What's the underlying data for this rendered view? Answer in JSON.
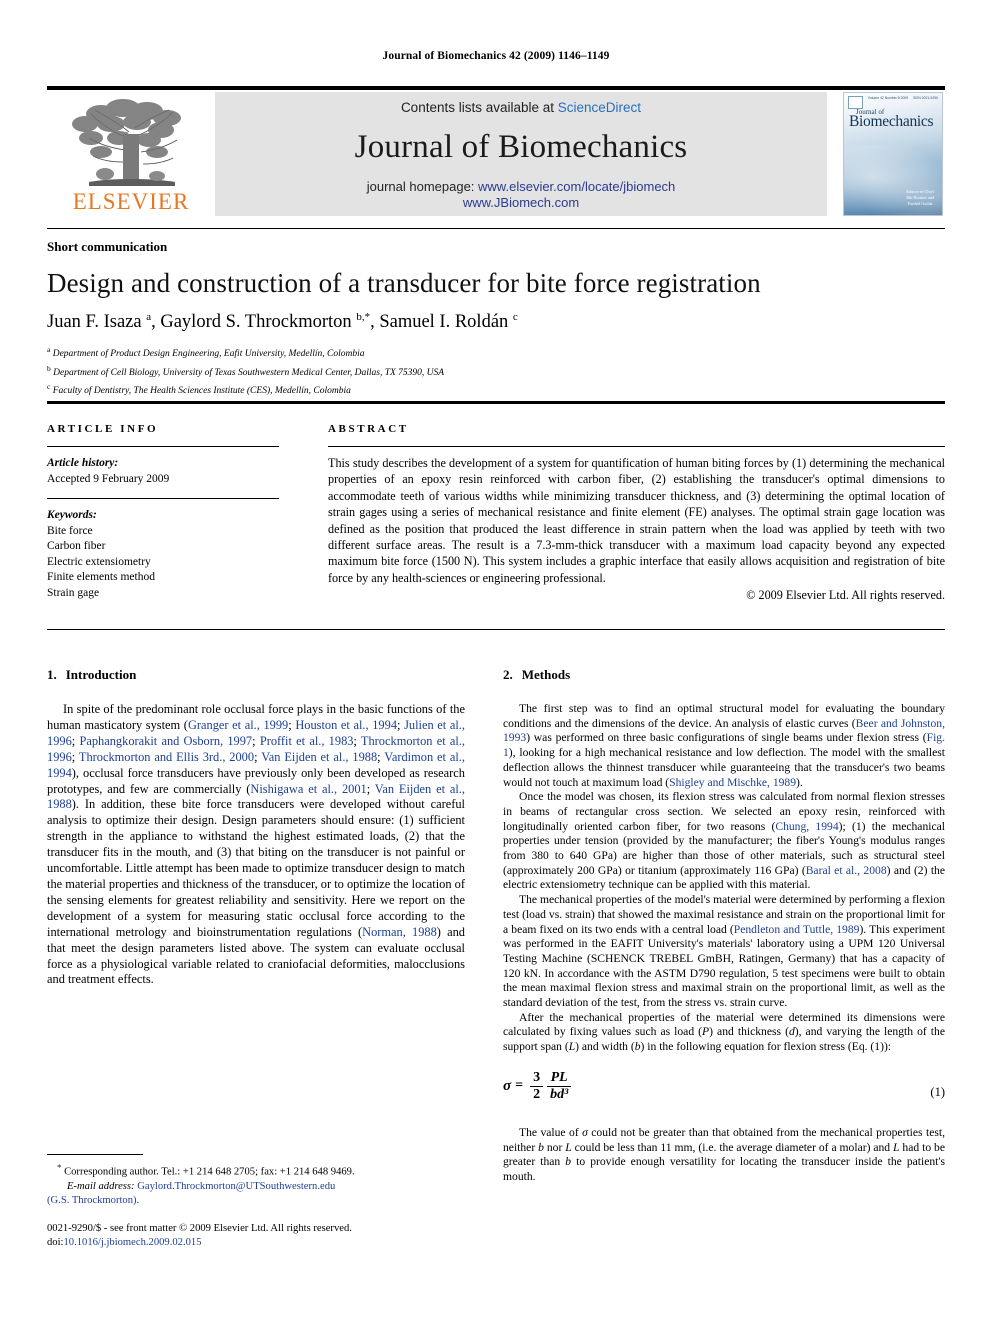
{
  "running_head": "Journal of Biomechanics 42 (2009) 1146–1149",
  "masthead": {
    "publisher_name": "ELSEVIER",
    "contents_prefix": "Contents lists available at ",
    "contents_link": "ScienceDirect",
    "journal_title": "Journal of Biomechanics",
    "homepage_prefix": "journal homepage: ",
    "homepage_url": "www.elsevier.com/locate/jbiomech",
    "homepage_url2": "www.JBiomech.com",
    "cover": {
      "volume_line": "Volume 42 Number 8 2009",
      "issn_line": "ISSN 0021-9290",
      "title_small": "Journal of",
      "title_large": "Biomechanics",
      "editors": "Editors-in-Chief\nRik Huiskes and\nFarshid Guilak"
    }
  },
  "article": {
    "doctype": "Short communication",
    "title": "Design and construction of a transducer for bite force registration",
    "authors_html": "Juan F. Isaza <sup>a</sup>, Gaylord S. Throckmorton <sup>b,*</sup>, Samuel I. Roldán <sup>c</sup>",
    "affiliations": [
      {
        "mark": "a",
        "text": "Department of Product Design Engineering, Eafit University, Medellín, Colombia"
      },
      {
        "mark": "b",
        "text": "Department of Cell Biology, University of Texas Southwestern Medical Center, Dallas, TX 75390, USA"
      },
      {
        "mark": "c",
        "text": "Faculty of Dentistry, The Health Sciences Institute (CES), Medellín, Colombia"
      }
    ]
  },
  "article_info": {
    "heading": "ARTICLE INFO",
    "history_label": "Article history:",
    "history_value": "Accepted 9 February 2009",
    "keywords_label": "Keywords:",
    "keywords": [
      "Bite force",
      "Carbon fiber",
      "Electric extensiometry",
      "Finite elements method",
      "Strain gage"
    ]
  },
  "abstract": {
    "heading": "ABSTRACT",
    "text": "This study describes the development of a system for quantification of human biting forces by (1) determining the mechanical properties of an epoxy resin reinforced with carbon fiber, (2) establishing the transducer's optimal dimensions to accommodate teeth of various widths while minimizing transducer thickness, and (3) determining the optimal location of strain gages using a series of mechanical resistance and finite element (FE) analyses. The optimal strain gage location was defined as the position that produced the least difference in strain pattern when the load was applied by teeth with two different surface areas. The result is a 7.3-mm-thick transducer with a maximum load capacity beyond any expected maximum bite force (1500 N). This system includes a graphic interface that easily allows acquisition and registration of bite force by any health-sciences or engineering professional.",
    "copyright": "© 2009 Elsevier Ltd. All rights reserved."
  },
  "sections": {
    "introduction": {
      "number": "1.",
      "title": "Introduction",
      "paragraph_html": "In spite of the predominant role occlusal force plays in the basic functions of the human masticatory system (<span class=\"cit\">Granger et al., 1999</span>; <span class=\"cit\">Houston et al., 1994</span>; <span class=\"cit\">Julien et al., 1996</span>; <span class=\"cit\">Paphangkorakit and Osborn, 1997</span>; <span class=\"cit\">Proffit et al., 1983</span>; <span class=\"cit\">Throckmorton et al., 1996</span>; <span class=\"cit\">Throckmorton and Ellis 3rd., 2000</span>; <span class=\"cit\">Van Eijden et al., 1988</span>; <span class=\"cit\">Vardimon et al., 1994</span>), occlusal force transducers have previously only been developed as research prototypes, and few are commercially (<span class=\"cit\">Nishigawa et al., 2001</span>; <span class=\"cit\">Van Eijden et al., 1988</span>). In addition, these bite force transducers were developed without careful analysis to optimize their design. Design parameters should ensure: (1) sufficient strength in the appliance to withstand the highest estimated loads, (2) that the transducer fits in the mouth, and (3) that biting on the transducer is not painful or uncomfortable. Little attempt has been made to optimize transducer design to match the material properties and thickness of the transducer, or to optimize the location of the sensing elements for greatest reliability and sensitivity. Here we report on the development of a system for measuring static occlusal force according to the international metrology and bioinstrumentation regulations (<span class=\"cit\">Norman, 1988</span>) and that meet the design parameters listed above. The system can evaluate occlusal force as a physiological variable related to craniofacial deformities, malocclusions and treatment effects."
    },
    "methods": {
      "number": "2.",
      "title": "Methods",
      "p1_html": "The first step was to find an optimal structural model for evaluating the boundary conditions and the dimensions of the device. An analysis of elastic curves (<span class=\"cit\">Beer and Johnston, 1993</span>) was performed on three basic configurations of single beams under flexion stress (<span class=\"cit\">Fig. 1</span>), looking for a high mechanical resistance and low deflection. The model with the smallest deflection allows the thinnest transducer while guaranteeing that the transducer's two beams would not touch at maximum load (<span class=\"cit\">Shigley and Mischke, 1989</span>).",
      "p2_html": "Once the model was chosen, its flexion stress was calculated from normal flexion stresses in beams of rectangular cross section. We selected an epoxy resin, reinforced with longitudinally oriented carbon fiber, for two reasons (<span class=\"cit\">Chung, 1994</span>); (1) the mechanical properties under tension (provided by the manufacturer; the fiber's Young's modulus ranges from 380 to 640 GPa) are higher than those of other materials, such as structural steel (approximately 200 GPa) or titanium (approximately 116 GPa) (<span class=\"cit\">Baral et al., 2008</span>) and (2) the electric extensiometry technique can be applied with this material.",
      "p3_html": "The mechanical properties of the model's material were determined by performing a flexion test (load vs. strain) that showed the maximal resistance and strain on the proportional limit for a beam fixed on its two ends with a central load (<span class=\"cit\">Pendleton and Tuttle, 1989</span>). This experiment was performed in the EAFIT University's materials' laboratory using a UPM 120 Universal Testing Machine (SCHENCK TREBEL GmBH, Ratingen, Germany) that has a capacity of 120 kN. In accordance with the ASTM D790 regulation, 5 test specimens were built to obtain the mean maximal flexion stress and maximal strain on the proportional limit, as well as the standard deviation of the test, from the stress vs. strain curve.",
      "p4_html": "After the mechanical properties of the material were determined its dimensions were calculated by fixing values such as load (<i>P</i>) and thickness (<i>d</i>), and varying the length of the support span (<i>L</i>) and width (<i>b</i>) in the following equation for flexion stress (Eq. (1)):",
      "p5_html": "The value of <i>σ</i> could not be greater than that obtained from the mechanical properties test, neither <i>b</i> nor <i>L</i> could be less than 11 mm, (i.e. the average diameter of a molar) and <i>L</i> had to be greater than <i>b</i> to provide enough versatility for locating the transducer inside the patient's mouth."
    }
  },
  "equation": {
    "sigma": "σ",
    "equals": "=",
    "frac1_num": "3",
    "frac1_den": "2",
    "frac2_num": "PL",
    "frac2_den": "bd³",
    "label": "(1)"
  },
  "footnotes": {
    "corresponding_html": "<sup>*</sup> Corresponding author. Tel.: +1 214 648 2705; fax: +1 214 648 9469.",
    "email_label": "E-mail address:",
    "email_value": "Gaylord.Throckmorton@UTSouthwestern.edu",
    "email_owner": "(G.S. Throckmorton).",
    "issn_line": "0021-9290/$ - see front matter © 2009 Elsevier Ltd. All rights reserved.",
    "doi_label": "doi:",
    "doi_value": "10.1016/j.jbiomech.2009.02.015"
  },
  "colors": {
    "link": "#2a6ebb",
    "citation": "#1c3f94",
    "elsevier_orange": "#E87722",
    "banner_bg": "#e3e3e3"
  }
}
